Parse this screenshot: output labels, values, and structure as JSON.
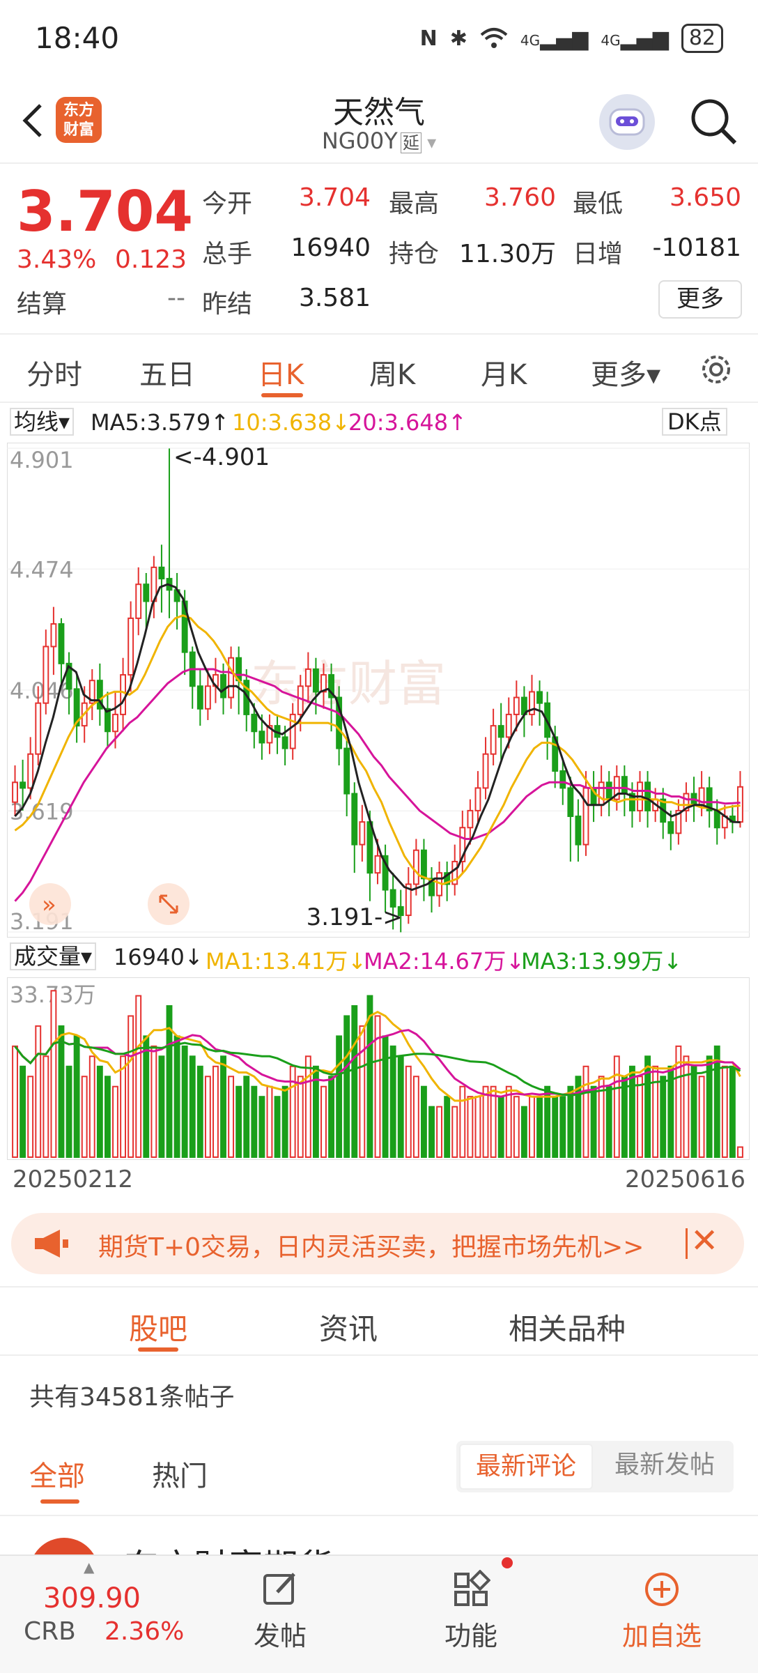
{
  "status_bar": {
    "time": "18:40",
    "battery": "82",
    "net1": "4G",
    "net2": "4G"
  },
  "header": {
    "back_icon": "chevron-left-icon",
    "logo_text": "东方\n财富",
    "title": "天然气",
    "code": "NG00Y",
    "delay_tag": "延",
    "search_icon": "search-icon"
  },
  "quote": {
    "price": "3.704",
    "change_pct": "3.43%",
    "change": "0.123",
    "settle_label": "结算",
    "settle_value": "--",
    "fields": [
      {
        "label": "今开",
        "value": "3.704",
        "color": "red"
      },
      {
        "label": "最高",
        "value": "3.760",
        "color": "red"
      },
      {
        "label": "最低",
        "value": "3.650",
        "color": "red"
      },
      {
        "label": "总手",
        "value": "16940",
        "color": "dark"
      },
      {
        "label": "持仓",
        "value": "11.30万",
        "color": "dark"
      },
      {
        "label": "日增",
        "value": "-10181",
        "color": "dark"
      },
      {
        "label": "昨结",
        "value": "3.581",
        "color": "dark"
      }
    ],
    "more_label": "更多"
  },
  "period_tabs": [
    "分时",
    "五日",
    "日K",
    "周K",
    "月K",
    "更多▾"
  ],
  "active_period": "日K",
  "ma_legend": {
    "type_label": "均线▾",
    "ma5": "MA5:3.579↑",
    "ma10": "10:3.638↓",
    "ma20": "20:3.648↑",
    "dk_label": "DK点"
  },
  "vol_legend": {
    "type_label": "成交量▾",
    "vol": "16940↓",
    "ma1": "MA1:13.41万↓",
    "ma2": "MA2:14.67万↓",
    "ma3": "MA3:13.99万↓"
  },
  "colors": {
    "up": "#e5312f",
    "down": "#1a9f1a",
    "ma5": "#222222",
    "ma10": "#f0b400",
    "ma20": "#d6149a",
    "accent": "#e8622e"
  },
  "chart_data": {
    "type": "candlestick",
    "start_date": "20250212",
    "end_date": "20250616",
    "y_ticks": [
      "4.901",
      "4.474",
      "4.046",
      "3.619",
      "3.191"
    ],
    "ylim": [
      3.191,
      4.901
    ],
    "high_marker": "<-4.901",
    "low_marker": "3.191->",
    "vol_max_label": "33.73万",
    "candles": [
      [
        3.65,
        3.72,
        3.6,
        3.78
      ],
      [
        3.72,
        3.7,
        3.62,
        3.8
      ],
      [
        3.7,
        3.82,
        3.66,
        3.88
      ],
      [
        3.82,
        4.0,
        3.78,
        4.06
      ],
      [
        4.0,
        4.2,
        3.96,
        4.26
      ],
      [
        4.2,
        4.28,
        4.1,
        4.34
      ],
      [
        4.28,
        4.14,
        4.06,
        4.3
      ],
      [
        4.14,
        4.05,
        3.96,
        4.18
      ],
      [
        4.05,
        3.92,
        3.86,
        4.1
      ],
      [
        3.92,
        4.0,
        3.86,
        4.06
      ],
      [
        4.0,
        4.08,
        3.94,
        4.12
      ],
      [
        4.08,
        3.98,
        3.92,
        4.14
      ],
      [
        3.98,
        3.9,
        3.84,
        4.04
      ],
      [
        3.9,
        3.96,
        3.84,
        4.04
      ],
      [
        3.96,
        4.1,
        3.9,
        4.16
      ],
      [
        4.1,
        4.3,
        4.04,
        4.36
      ],
      [
        4.3,
        4.42,
        4.24,
        4.48
      ],
      [
        4.42,
        4.36,
        4.26,
        4.46
      ],
      [
        4.36,
        4.48,
        4.3,
        4.52
      ],
      [
        4.48,
        4.44,
        4.32,
        4.56
      ],
      [
        4.44,
        4.4,
        4.3,
        4.9
      ],
      [
        4.4,
        4.36,
        4.26,
        4.46
      ],
      [
        4.36,
        4.18,
        4.1,
        4.4
      ],
      [
        4.18,
        4.06,
        3.98,
        4.2
      ],
      [
        4.06,
        3.98,
        3.92,
        4.12
      ],
      [
        3.98,
        4.06,
        3.94,
        4.12
      ],
      [
        4.06,
        4.1,
        4.0,
        4.16
      ],
      [
        4.1,
        4.02,
        3.96,
        4.14
      ],
      [
        4.02,
        4.16,
        3.98,
        4.2
      ],
      [
        4.16,
        4.08,
        3.96,
        4.2
      ],
      [
        4.08,
        3.96,
        3.9,
        4.12
      ],
      [
        3.96,
        3.9,
        3.84,
        4.0
      ],
      [
        3.9,
        3.86,
        3.8,
        3.96
      ],
      [
        3.86,
        3.92,
        3.82,
        3.96
      ],
      [
        3.92,
        3.88,
        3.82,
        3.96
      ],
      [
        3.88,
        3.84,
        3.78,
        3.92
      ],
      [
        3.84,
        3.96,
        3.8,
        4.0
      ],
      [
        3.96,
        4.06,
        3.9,
        4.1
      ],
      [
        4.06,
        4.12,
        4.0,
        4.18
      ],
      [
        4.12,
        4.04,
        3.96,
        4.16
      ],
      [
        4.04,
        4.1,
        3.98,
        4.14
      ],
      [
        4.1,
        4.02,
        3.9,
        4.14
      ],
      [
        4.02,
        3.84,
        3.78,
        4.06
      ],
      [
        3.84,
        3.68,
        3.6,
        3.88
      ],
      [
        3.68,
        3.5,
        3.4,
        3.72
      ],
      [
        3.5,
        3.58,
        3.44,
        3.64
      ],
      [
        3.58,
        3.4,
        3.3,
        3.62
      ],
      [
        3.4,
        3.46,
        3.36,
        3.52
      ],
      [
        3.46,
        3.34,
        3.26,
        3.5
      ],
      [
        3.34,
        3.28,
        3.2,
        3.4
      ],
      [
        3.28,
        3.25,
        3.19,
        3.34
      ],
      [
        3.25,
        3.36,
        3.22,
        3.42
      ],
      [
        3.36,
        3.48,
        3.32,
        3.52
      ],
      [
        3.48,
        3.38,
        3.3,
        3.52
      ],
      [
        3.38,
        3.32,
        3.26,
        3.42
      ],
      [
        3.32,
        3.4,
        3.28,
        3.44
      ],
      [
        3.4,
        3.36,
        3.3,
        3.44
      ],
      [
        3.36,
        3.44,
        3.32,
        3.5
      ],
      [
        3.44,
        3.56,
        3.4,
        3.62
      ],
      [
        3.56,
        3.62,
        3.5,
        3.66
      ],
      [
        3.62,
        3.7,
        3.58,
        3.76
      ],
      [
        3.7,
        3.82,
        3.66,
        3.88
      ],
      [
        3.82,
        3.92,
        3.78,
        3.98
      ],
      [
        3.92,
        3.88,
        3.8,
        4.0
      ],
      [
        3.88,
        3.96,
        3.84,
        4.02
      ],
      [
        3.96,
        4.02,
        3.9,
        4.08
      ],
      [
        4.02,
        3.96,
        3.88,
        4.06
      ],
      [
        3.96,
        4.04,
        3.92,
        4.1
      ],
      [
        4.04,
        4.0,
        3.92,
        4.08
      ],
      [
        4.0,
        3.88,
        3.8,
        4.04
      ],
      [
        3.88,
        3.76,
        3.7,
        3.92
      ],
      [
        3.76,
        3.7,
        3.64,
        3.8
      ],
      [
        3.7,
        3.6,
        3.44,
        3.74
      ],
      [
        3.6,
        3.5,
        3.44,
        3.66
      ],
      [
        3.5,
        3.7,
        3.46,
        3.76
      ],
      [
        3.7,
        3.64,
        3.58,
        3.76
      ],
      [
        3.64,
        3.72,
        3.6,
        3.78
      ],
      [
        3.72,
        3.66,
        3.6,
        3.76
      ],
      [
        3.66,
        3.74,
        3.62,
        3.78
      ],
      [
        3.74,
        3.68,
        3.6,
        3.78
      ],
      [
        3.68,
        3.62,
        3.56,
        3.72
      ],
      [
        3.62,
        3.72,
        3.58,
        3.76
      ],
      [
        3.72,
        3.62,
        3.56,
        3.76
      ],
      [
        3.62,
        3.66,
        3.58,
        3.7
      ],
      [
        3.66,
        3.58,
        3.52,
        3.7
      ],
      [
        3.58,
        3.54,
        3.48,
        3.62
      ],
      [
        3.54,
        3.62,
        3.5,
        3.66
      ],
      [
        3.62,
        3.68,
        3.58,
        3.72
      ],
      [
        3.68,
        3.64,
        3.58,
        3.74
      ],
      [
        3.64,
        3.7,
        3.6,
        3.76
      ],
      [
        3.7,
        3.62,
        3.56,
        3.74
      ],
      [
        3.62,
        3.56,
        3.5,
        3.66
      ],
      [
        3.56,
        3.6,
        3.52,
        3.64
      ],
      [
        3.6,
        3.58,
        3.54,
        3.64
      ],
      [
        3.58,
        3.704,
        3.56,
        3.76
      ]
    ],
    "volumes": [
      0.22,
      0.18,
      0.16,
      0.26,
      0.2,
      0.33,
      0.26,
      0.18,
      0.24,
      0.16,
      0.2,
      0.18,
      0.16,
      0.14,
      0.2,
      0.28,
      0.32,
      0.24,
      0.22,
      0.2,
      0.3,
      0.24,
      0.22,
      0.2,
      0.18,
      0.16,
      0.18,
      0.2,
      0.16,
      0.14,
      0.16,
      0.14,
      0.12,
      0.14,
      0.12,
      0.14,
      0.18,
      0.16,
      0.2,
      0.18,
      0.14,
      0.16,
      0.24,
      0.28,
      0.3,
      0.26,
      0.32,
      0.28,
      0.24,
      0.22,
      0.2,
      0.18,
      0.16,
      0.14,
      0.1,
      0.1,
      0.12,
      0.1,
      0.14,
      0.12,
      0.12,
      0.14,
      0.14,
      0.12,
      0.14,
      0.12,
      0.1,
      0.12,
      0.12,
      0.14,
      0.12,
      0.12,
      0.14,
      0.16,
      0.18,
      0.14,
      0.16,
      0.14,
      0.2,
      0.16,
      0.18,
      0.16,
      0.2,
      0.18,
      0.16,
      0.18,
      0.22,
      0.2,
      0.18,
      0.16,
      0.2,
      0.22,
      0.18,
      0.18,
      0.02
    ],
    "ma5": [
      3.6,
      3.63,
      3.68,
      3.76,
      3.86,
      3.95,
      4.06,
      4.13,
      4.11,
      4.03,
      4.01,
      4.01,
      3.97,
      3.98,
      4.0,
      4.05,
      4.14,
      4.24,
      4.35,
      4.41,
      4.42,
      4.41,
      4.37,
      4.27,
      4.18,
      4.12,
      4.07,
      4.04,
      4.06,
      4.06,
      4.04,
      4.0,
      3.95,
      3.92,
      3.9,
      3.89,
      3.91,
      3.93,
      3.97,
      4.01,
      4.04,
      4.05,
      4.02,
      3.94,
      3.84,
      3.72,
      3.63,
      3.54,
      3.46,
      3.41,
      3.38,
      3.35,
      3.34,
      3.35,
      3.36,
      3.38,
      3.38,
      3.4,
      3.42,
      3.48,
      3.53,
      3.6,
      3.66,
      3.74,
      3.82,
      3.88,
      3.93,
      3.97,
      3.98,
      3.97,
      3.92,
      3.86,
      3.78,
      3.71,
      3.68,
      3.64,
      3.64,
      3.64,
      3.66,
      3.68,
      3.68,
      3.67,
      3.67,
      3.66,
      3.64,
      3.62,
      3.6,
      3.61,
      3.63,
      3.64,
      3.64,
      3.63,
      3.62,
      3.6,
      3.58,
      3.579
    ],
    "ma10": [
      3.55,
      3.57,
      3.6,
      3.64,
      3.7,
      3.76,
      3.82,
      3.88,
      3.93,
      3.96,
      3.99,
      4.01,
      4.03,
      4.04,
      4.04,
      4.03,
      4.05,
      4.1,
      4.16,
      4.22,
      4.27,
      4.3,
      4.31,
      4.3,
      4.27,
      4.25,
      4.22,
      4.18,
      4.13,
      4.09,
      4.06,
      4.04,
      4.01,
      3.98,
      3.96,
      3.95,
      3.94,
      3.93,
      3.93,
      3.93,
      3.93,
      3.93,
      3.92,
      3.89,
      3.85,
      3.8,
      3.76,
      3.7,
      3.65,
      3.58,
      3.52,
      3.46,
      3.42,
      3.39,
      3.38,
      3.37,
      3.36,
      3.37,
      3.38,
      3.41,
      3.45,
      3.49,
      3.54,
      3.59,
      3.64,
      3.7,
      3.75,
      3.8,
      3.84,
      3.86,
      3.86,
      3.85,
      3.83,
      3.8,
      3.76,
      3.72,
      3.68,
      3.66,
      3.66,
      3.65,
      3.66,
      3.66,
      3.66,
      3.66,
      3.66,
      3.65,
      3.65,
      3.64,
      3.64,
      3.64,
      3.63,
      3.63,
      3.62,
      3.63,
      3.635,
      3.638
    ],
    "ma20": [
      3.3,
      3.33,
      3.37,
      3.42,
      3.47,
      3.52,
      3.57,
      3.62,
      3.67,
      3.72,
      3.76,
      3.8,
      3.84,
      3.87,
      3.9,
      3.93,
      3.95,
      3.98,
      4.01,
      4.04,
      4.07,
      4.09,
      4.11,
      4.12,
      4.12,
      4.12,
      4.12,
      4.11,
      4.11,
      4.1,
      4.1,
      4.09,
      4.08,
      4.07,
      4.06,
      4.04,
      4.03,
      4.02,
      4.01,
      4.0,
      3.99,
      3.98,
      3.97,
      3.95,
      3.92,
      3.89,
      3.85,
      3.81,
      3.78,
      3.74,
      3.71,
      3.68,
      3.65,
      3.62,
      3.6,
      3.58,
      3.56,
      3.54,
      3.53,
      3.52,
      3.52,
      3.53,
      3.54,
      3.56,
      3.58,
      3.61,
      3.64,
      3.67,
      3.69,
      3.71,
      3.72,
      3.72,
      3.72,
      3.71,
      3.71,
      3.7,
      3.7,
      3.7,
      3.7,
      3.7,
      3.7,
      3.69,
      3.69,
      3.69,
      3.68,
      3.68,
      3.67,
      3.67,
      3.66,
      3.66,
      3.65,
      3.65,
      3.65,
      3.645,
      3.646,
      3.648
    ]
  },
  "banner": {
    "text": "期货T+0交易，日内灵活买卖，把握市场先机>>",
    "close_icon": "close-icon"
  },
  "section_tabs": [
    "股吧",
    "资讯",
    "相关品种"
  ],
  "post_count": "共有34581条帖子",
  "filter": {
    "all": "全部",
    "hot": "热门",
    "sort_comment": "最新评论",
    "sort_post": "最新发帖"
  },
  "post_peek_author": "东方财富期货",
  "bottom_bar": {
    "crb_value": "309.90",
    "crb_label": "CRB",
    "crb_pct": "2.36%",
    "post_label": "发帖",
    "func_label": "功能",
    "watch_label": "加自选"
  }
}
